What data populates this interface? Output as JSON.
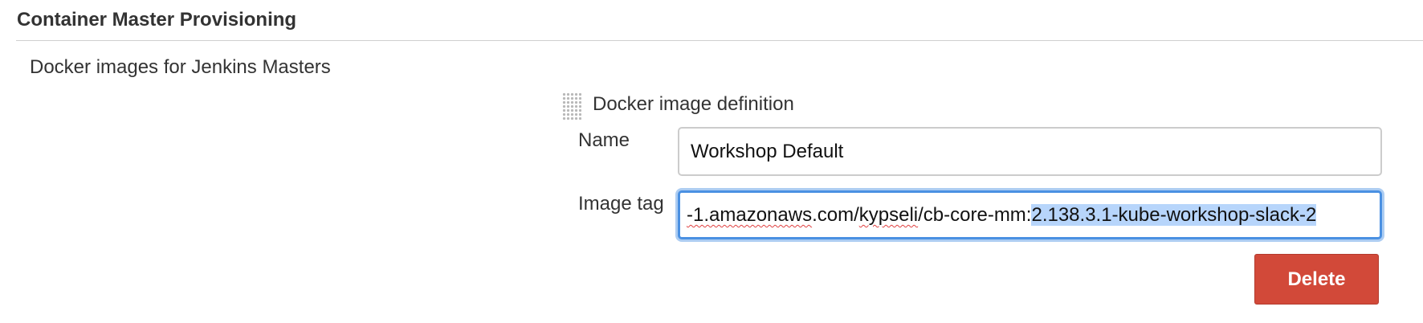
{
  "section": {
    "title": "Container Master Provisioning"
  },
  "subsection": {
    "label": "Docker images for Jenkins Masters"
  },
  "image_definition": {
    "title": "Docker image definition",
    "name_label": "Name",
    "name_value": "Workshop Default",
    "tag_label": "Image tag",
    "tag_value_visible": {
      "part1": "-1.",
      "part2": "amazonaws",
      "part3": ".com/",
      "part4": "kypseli",
      "part5": "/cb-core-mm:",
      "selected": "2.138.3.1-kube-workshop-slack-2"
    },
    "delete_label": "Delete"
  },
  "colors": {
    "delete_button": "#d24939",
    "focus_ring": "#4a90e2",
    "selection": "#b7d5fb"
  },
  "icons": {
    "drag_handle": "drag-handle-icon"
  }
}
